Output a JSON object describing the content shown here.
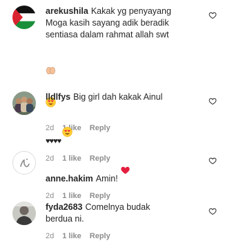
{
  "comments": [
    {
      "username": "arekushila",
      "text": "Kakak yg penyayang\nMoga kasih sayang adik beradik\nsentiasa dalam rahmat allah swt",
      "emojis": [
        "folded-hands-emoji",
        "heart-eyes-emoji"
      ],
      "time": "2d",
      "likes": "1 like",
      "reply": "Reply",
      "avatar_icon": "palestine-flag-avatar"
    },
    {
      "username": "lldlfys",
      "text": "Big girl dah kakak Ainul",
      "hearts": "♥♥♥♥",
      "emojis": [
        "heart-eyes-emoji"
      ],
      "time": "2d",
      "likes": "1 like",
      "reply": "Reply",
      "avatar_icon": "group-photo-avatar"
    },
    {
      "username": "anne.hakim",
      "text": "Amin!",
      "emojis": [
        "red-heart-emoji"
      ],
      "time": "2d",
      "likes": "1 like",
      "reply": "Reply",
      "avatar_icon": "calligraphy-avatar"
    },
    {
      "username": "fyda2683",
      "text": "Comelnya budak\nberdua ni.",
      "time": "2d",
      "likes": "1 like",
      "reply": "Reply",
      "avatar_icon": "person-photo-avatar"
    }
  ],
  "colors": {
    "text": "#262626",
    "meta": "#8e8e8e",
    "heart_red": "#ed4956"
  }
}
